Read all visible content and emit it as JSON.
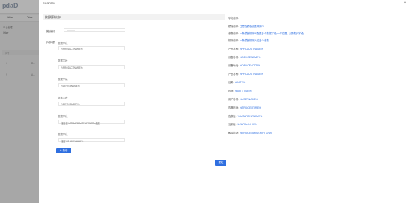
{
  "background": {
    "brand": "pdaD",
    "tabs": [
      "Other",
      "Other"
    ],
    "nav": [
      "中台管理",
      "Other"
    ],
    "table_header": "序号",
    "rows": [
      {
        "num": "1",
        "code": "ALL"
      },
      {
        "num": "2",
        "code": "ALL"
      }
    ]
  },
  "dialog": {
    "title": "CONFIRM",
    "close_label": "×",
    "panel_title": "数据规则维护",
    "id_label": "模板编号",
    "fields_label": "字段列表",
    "fields": [
      {
        "label": "数据字段",
        "value": "%PRODUCTNAME%"
      },
      {
        "label": "数据字段",
        "value": "%PRODUCTNAME%"
      },
      {
        "label": "数据字段",
        "value": "%DEVICENAME%"
      },
      {
        "label": "数据字段",
        "value": "%DEVICEADDR%"
      },
      {
        "label": "数据字段",
        "value": "温度值%CREATEDATE%FENGRA温度"
      },
      {
        "label": "数据字段",
        "value": "温度%SHOWVALUE%"
      }
    ],
    "add_label": "新增",
    "submit_label": "提交"
  },
  "help": {
    "title": "字段说明:",
    "lines": [
      {
        "k": "模版说明: ",
        "v": "注意在模版设置规则中"
      },
      {
        "k": "参数说明: ",
        "v": "一条模板规则可配置多个数据字段(一个位置, 以便表示字段)"
      },
      {
        "k": "规则说明: ",
        "v": "一条模板规则对应多个参数"
      },
      {
        "k": "产品名称: ",
        "v": "%PRODUCTNAME%"
      },
      {
        "k": "设备名称: ",
        "v": "%DEVICENAME%"
      },
      {
        "k": "设备地址: ",
        "v": "%DEVICEADDR%"
      },
      {
        "k": "产品名称: ",
        "v": "%PRODUCTNAME%"
      },
      {
        "k": "日期: ",
        "v": "%DATE%"
      },
      {
        "k": "时间: ",
        "v": "%DATETIME%"
      },
      {
        "k": "用户名称: ",
        "v": "%USERNAME%"
      },
      {
        "k": "告警时间: ",
        "v": "%TRIGGERTIME%"
      },
      {
        "k": "告警值: ",
        "v": "%DATAPOINTNAME%"
      },
      {
        "k": "当前值: ",
        "v": "%SHOWVALUE%"
      },
      {
        "k": "触发描述: ",
        "v": "%TRIGGERDESCRIPTION%"
      }
    ]
  },
  "colors": {
    "accent": "#2f6fe0",
    "overlay": "rgba(0,0,0,0.30)"
  }
}
